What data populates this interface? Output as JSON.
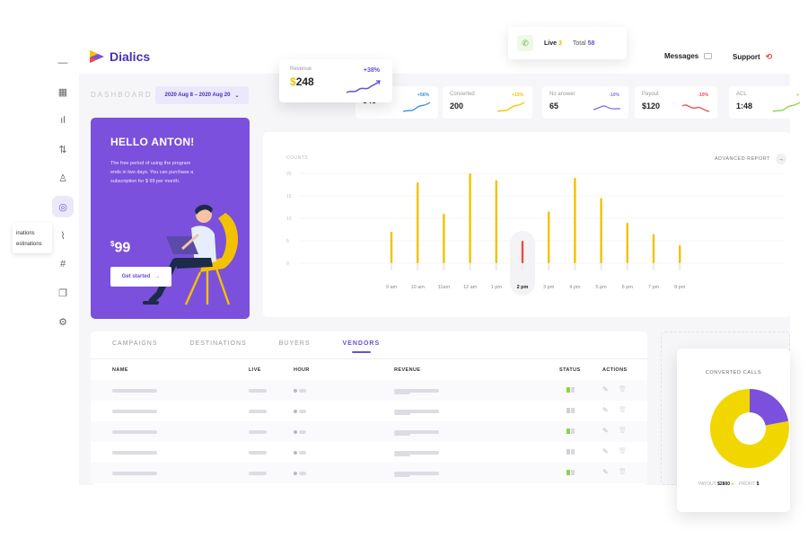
{
  "app": {
    "name": "Dialics"
  },
  "header": {
    "call_status": {
      "live_label": "Live",
      "live_count": "3",
      "total_label": "Total",
      "total_count": "58"
    },
    "messages_label": "Messages",
    "support_label": "Support"
  },
  "sidebar": {
    "icons": [
      "minus-icon",
      "grid-icon",
      "bar-chart-icon",
      "transfer-icon",
      "users-icon",
      "target-icon",
      "route-icon",
      "number-icon",
      "copy-icon",
      "settings-icon"
    ],
    "flyout_items": [
      "inations",
      "estinations"
    ]
  },
  "dashboard": {
    "title": "DASHBOARD",
    "date_range": "2020 Aug 8 – 2020 Aug 20"
  },
  "revenue_card": {
    "label": "Revenue",
    "value": "248",
    "currency": "$",
    "change": "+38%"
  },
  "stats": [
    {
      "label": "",
      "value": "345",
      "change": "+56%",
      "trend": "up",
      "color": "#3b8fe0"
    },
    {
      "label": "Converted",
      "value": "200",
      "change": "+15%",
      "trend": "up",
      "color": "#f2c200"
    },
    {
      "label": "No answer",
      "value": "65",
      "change": "-10%",
      "trend": "flat",
      "color": "#8a6fe0"
    },
    {
      "label": "Payout",
      "value": "$120",
      "change": "-10%",
      "trend": "down",
      "color": "#e84d4d"
    },
    {
      "label": "ACL",
      "value": "1:48",
      "change": "+",
      "trend": "up",
      "color": "#8bd34a"
    }
  ],
  "hello": {
    "title": "HELLO ANTON!",
    "message": "The free period of using the program ends in two days. You can purchase a subscription for $ 99 per month.",
    "price_currency": "$",
    "price": "99",
    "cta": "Get started"
  },
  "chart": {
    "counts_label": "COUNTS",
    "advanced_report": "ADVANCED REPORT"
  },
  "chart_data": {
    "type": "bar",
    "categories": [
      "9 am",
      "10 am",
      "11am",
      "12 am",
      "1 pm",
      "2 pm",
      "3 pm",
      "4 pm",
      "5 pm",
      "6 pm",
      "7 pm",
      "8 pm"
    ],
    "values": [
      7,
      18,
      11,
      20,
      18.5,
      5,
      11.5,
      19,
      14.5,
      9,
      6.5,
      4
    ],
    "highlight_index": 5,
    "yticks": [
      0,
      5,
      10,
      15,
      20
    ],
    "ylim": [
      0,
      20
    ],
    "bar_color": "#f2c200",
    "highlight_color": "#e84d4d",
    "title": "",
    "xlabel": "",
    "ylabel": "COUNTS"
  },
  "table": {
    "tabs": [
      "CAMPAIGNS",
      "DESTINATIONS",
      "BUYERS",
      "VENDORS"
    ],
    "active_tab": 3,
    "columns": [
      "NAME",
      "LIVE",
      "HOUR",
      "REVENUE",
      "STATUS",
      "ACTIONS"
    ],
    "rows": [
      {
        "status": "active"
      },
      {
        "status": "inactive"
      },
      {
        "status": "active"
      },
      {
        "status": "inactive"
      },
      {
        "status": "active"
      }
    ]
  },
  "converted_calls": {
    "title": "CONVERTED CALLS",
    "payout_label": "PAYOUT",
    "payout_value": "$2800",
    "profit_label": "PROFIT",
    "profit_value": "$",
    "payout_share": 0.78,
    "colors": {
      "payout": "#f2d600",
      "profit": "#7b50dc"
    }
  }
}
